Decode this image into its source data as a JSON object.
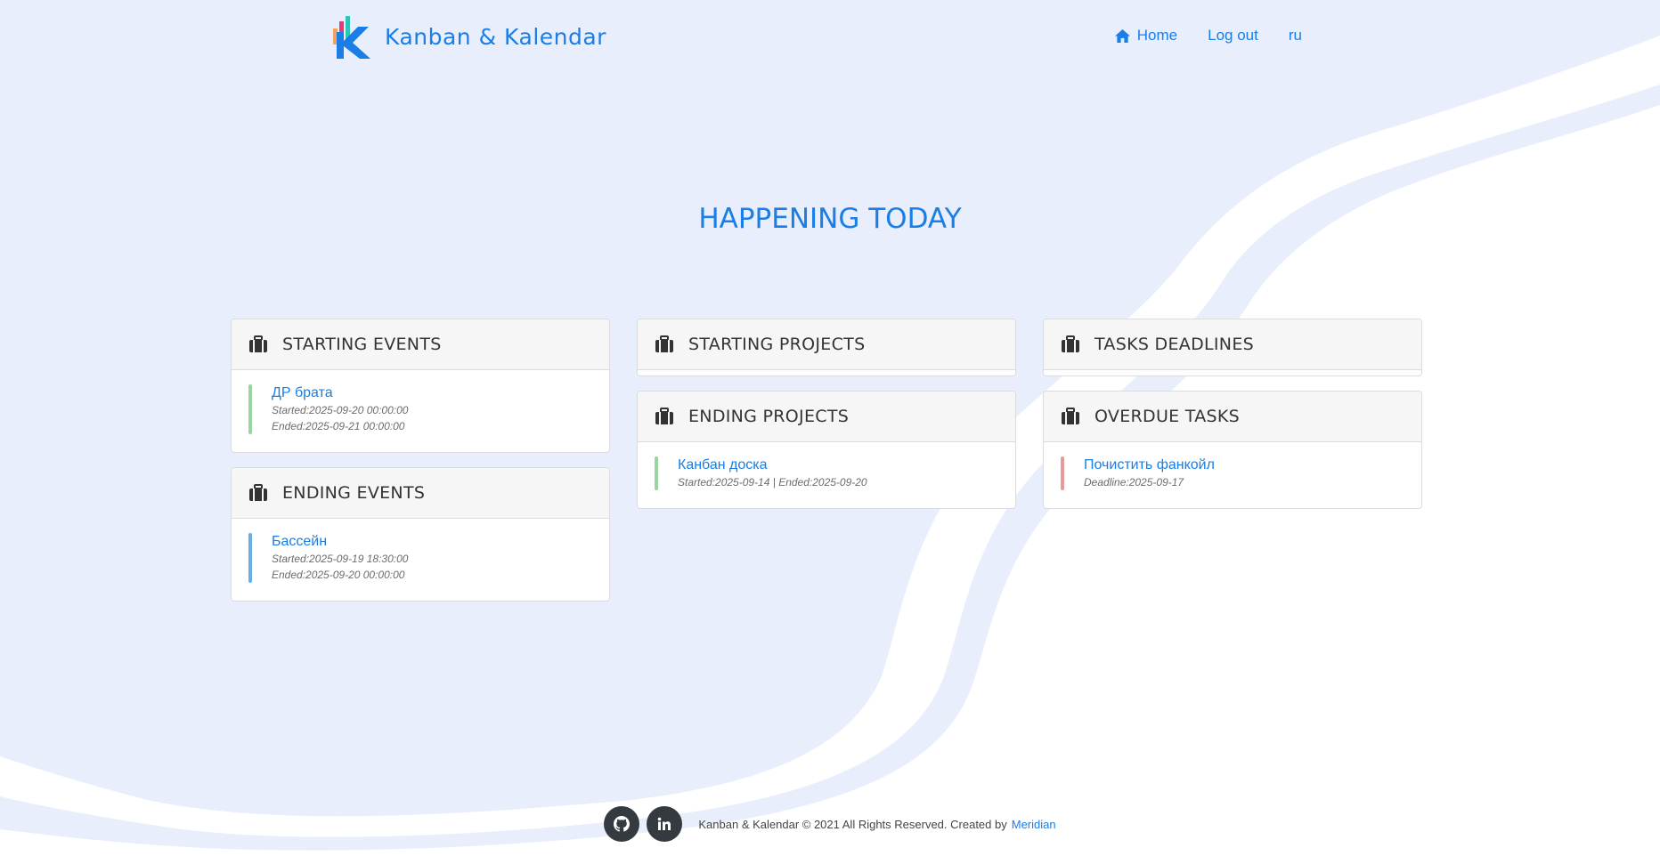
{
  "header": {
    "brand_name": "Kanban & Kalendar",
    "nav": [
      {
        "label": "Home",
        "icon": "home-icon"
      },
      {
        "label": "Log out"
      },
      {
        "label": "ru"
      }
    ]
  },
  "main": {
    "title": "HAPPENING TODAY",
    "cards": {
      "starting_events": {
        "title": "STARTING EVENTS",
        "icon": "briefcase-icon",
        "items": [
          {
            "name": "ДР брата",
            "line1": "Started:2025-09-20 00:00:00",
            "line2": "Ended:2025-09-21 00:00:00",
            "color": "#9ad5a1"
          }
        ]
      },
      "ending_events": {
        "title": "ENDING EVENTS",
        "icon": "briefcase-icon",
        "items": [
          {
            "name": "Бассейн",
            "line1": "Started:2025-09-19 18:30:00",
            "line2": "Ended:2025-09-20 00:00:00",
            "color": "#6aaee6"
          }
        ]
      },
      "starting_projects": {
        "title": "STARTING PROJECTS",
        "icon": "briefcase-icon",
        "items": []
      },
      "ending_projects": {
        "title": "ENDING PROJECTS",
        "icon": "briefcase-icon",
        "items": [
          {
            "name": "Канбан доска",
            "line1": "Started:2025-09-14 | Ended:2025-09-20",
            "color": "#9ad5a1"
          }
        ]
      },
      "tasks_deadlines": {
        "title": "TASKS DEADLINES",
        "icon": "briefcase-icon",
        "items": []
      },
      "overdue_tasks": {
        "title": "OVERDUE TASKS",
        "icon": "briefcase-icon",
        "items": [
          {
            "name": "Почистить фанкойл",
            "line1": "Deadline:2025-09-17",
            "color": "#e89a9a"
          }
        ]
      }
    }
  },
  "footer": {
    "social": [
      {
        "icon": "github-icon"
      },
      {
        "icon": "linkedin-icon"
      }
    ],
    "copyright": "Kanban & Kalendar © 2021 All Rights Reserved. Created by",
    "author": "Meridian"
  },
  "colors": {
    "accent": "#1a7ee6",
    "background": "#e8eefb",
    "card_header": "#f6f6f6"
  }
}
